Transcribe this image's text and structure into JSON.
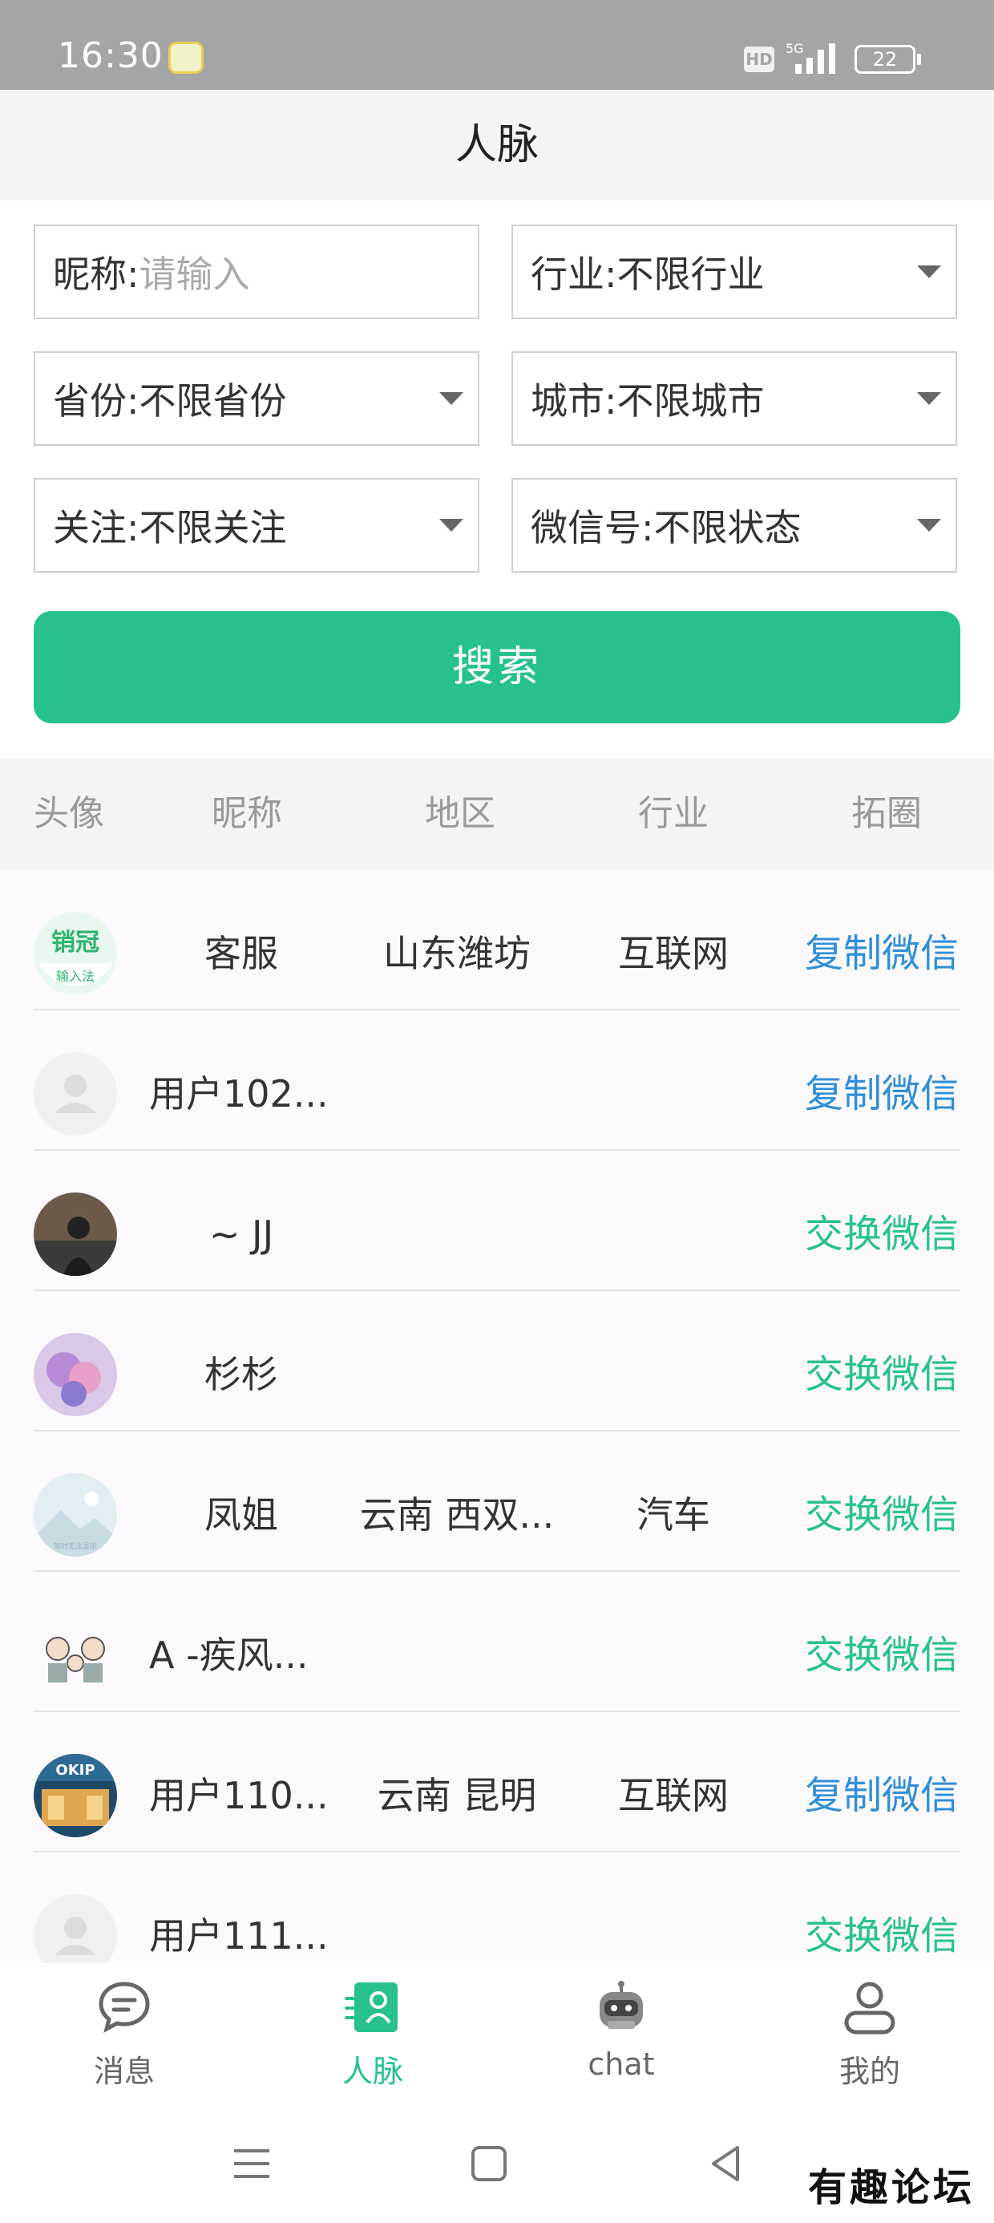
{
  "status_bar": {
    "time": "16:30",
    "hd": "HD",
    "network": "5G",
    "battery": "22"
  },
  "header": {
    "title": "人脉"
  },
  "filters": {
    "nickname_label": "昵称:",
    "nickname_placeholder": "请输入",
    "industry": "行业:不限行业",
    "province": "省份:不限省份",
    "city": "城市:不限城市",
    "follow": "关注:不限关注",
    "wechat": "微信号:不限状态",
    "search_label": "搜索"
  },
  "columns": [
    "头像",
    "昵称",
    "地区",
    "行业",
    "拓圈"
  ],
  "rows": [
    {
      "nickname": "客服",
      "region": "山东潍坊",
      "industry": "互联网",
      "action": "复制微信"
    },
    {
      "nickname": "用户102...",
      "region": "",
      "industry": "",
      "action": "复制微信"
    },
    {
      "nickname": "~ JJ",
      "region": "",
      "industry": "",
      "action": "交换微信"
    },
    {
      "nickname": "杉杉",
      "region": "",
      "industry": "",
      "action": "交换微信"
    },
    {
      "nickname": "凤姐",
      "region": "云南 西双...",
      "industry": "汽车",
      "action": "交换微信"
    },
    {
      "nickname": "A -疾风...",
      "region": "",
      "industry": "",
      "action": "交换微信"
    },
    {
      "nickname": "用户110...",
      "region": "云南 昆明",
      "industry": "互联网",
      "action": "复制微信"
    },
    {
      "nickname": "用户111...",
      "region": "",
      "industry": "",
      "action": "交换微信"
    }
  ],
  "avatar_texts": {
    "logo_top": "销冠",
    "logo_bottom": "输入法",
    "placeholder_caption": "暂时无法显示",
    "shop_sign": "OKIP"
  },
  "tabs": [
    {
      "label": "消息",
      "icon": "message-icon"
    },
    {
      "label": "人脉",
      "icon": "contacts-icon"
    },
    {
      "label": "chat",
      "icon": "robot-icon"
    },
    {
      "label": "我的",
      "icon": "profile-icon"
    }
  ],
  "watermark": "有趣论坛",
  "colors": {
    "accent": "#27c28a",
    "link_blue": "#2f8fd8",
    "status_bar": "#a5a5a5"
  }
}
